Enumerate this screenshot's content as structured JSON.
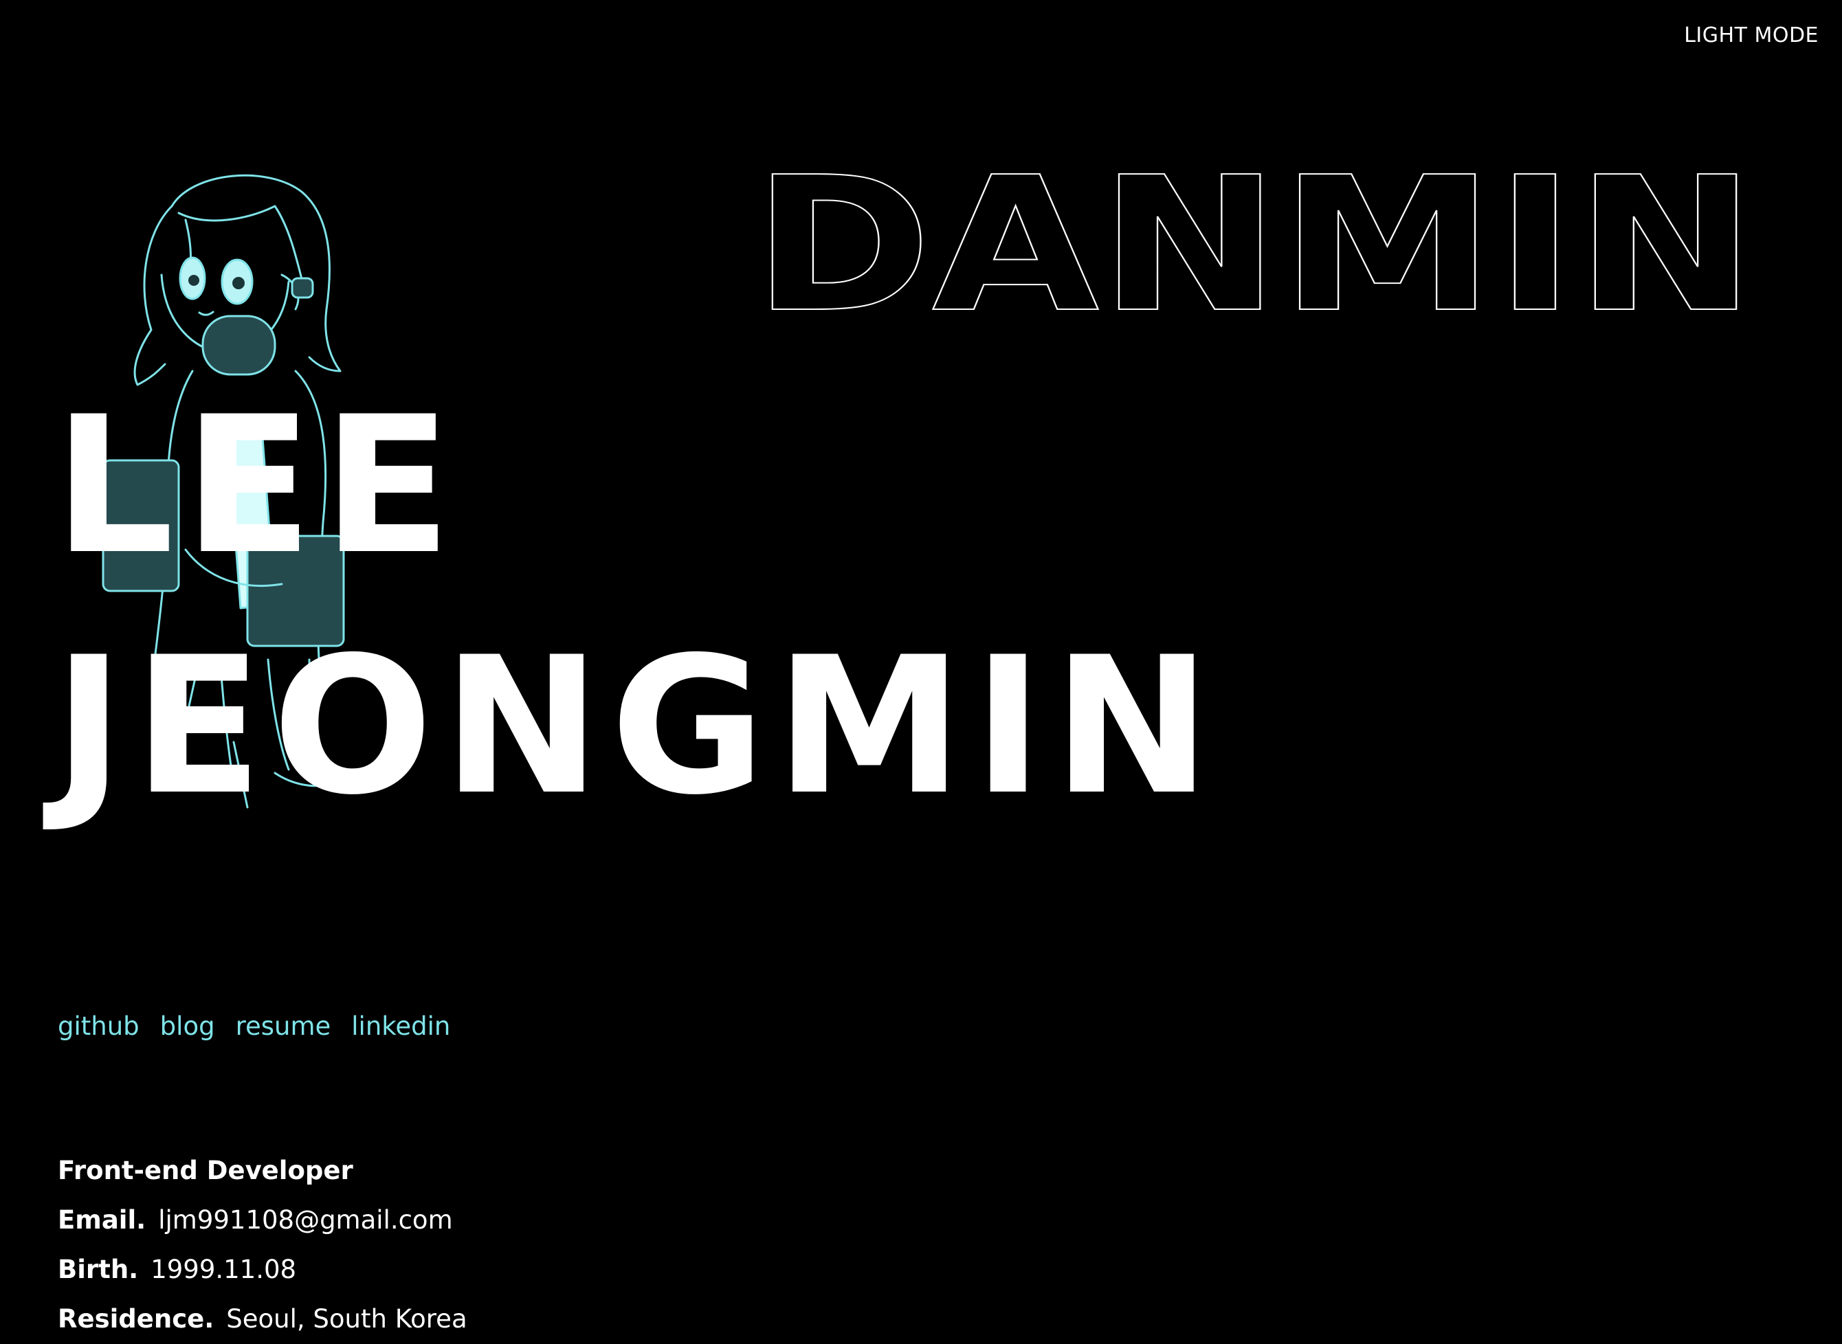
{
  "header": {
    "mode_toggle_label": "LIGHT MODE"
  },
  "hero": {
    "outline_title": "DANMIN",
    "first_name_line": "LEE",
    "last_name_line": "JEONGMIN"
  },
  "colors": {
    "background": "#000000",
    "text": "#ffffff",
    "accent": "#7fe3e8"
  },
  "links": [
    {
      "label": "github"
    },
    {
      "label": "blog"
    },
    {
      "label": "resume"
    },
    {
      "label": "linkedin"
    }
  ],
  "profile": {
    "role": "Front-end Developer",
    "email_label": "Email.",
    "email_value": "ljm991108@gmail.com",
    "birth_label": "Birth.",
    "birth_value": "1999.11.08",
    "residence_label": "Residence.",
    "residence_value": "Seoul, South Korea"
  }
}
